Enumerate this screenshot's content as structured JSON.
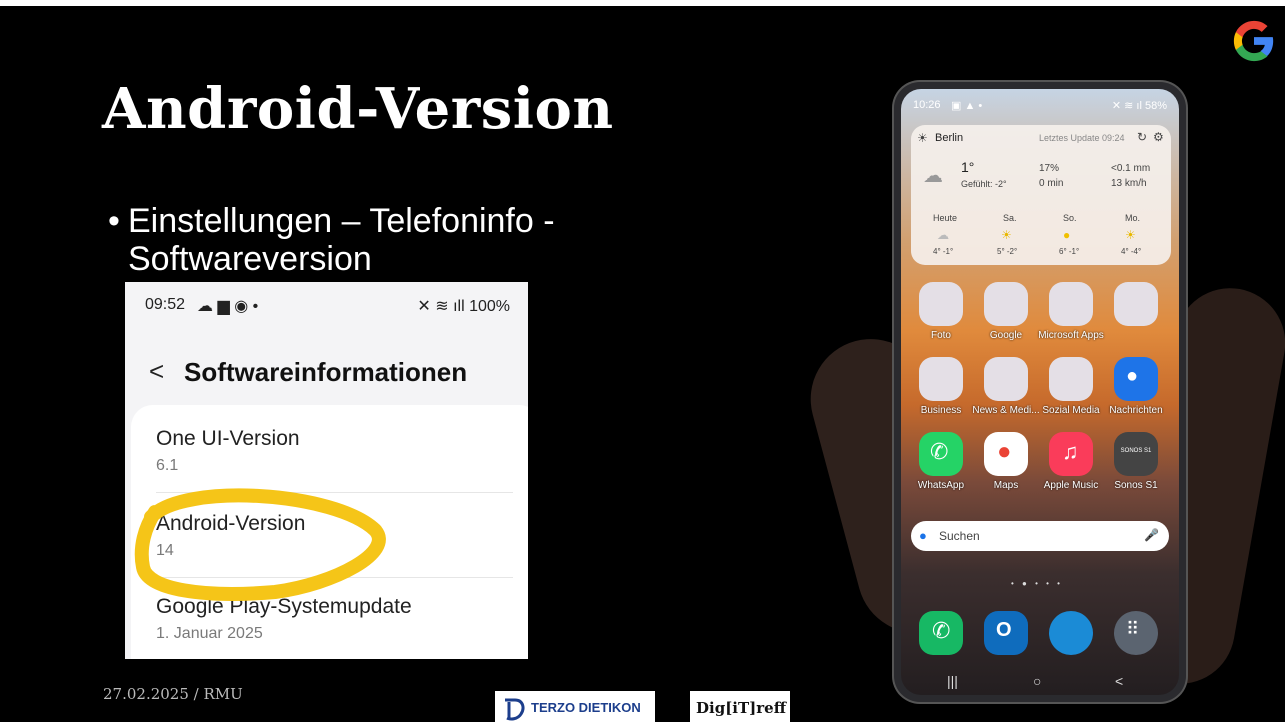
{
  "slide": {
    "title": "Android-Version",
    "bullet": "Einstellungen – Telefoninfo - Softwareversion",
    "footer_date": "27.02.2025 / RMU",
    "logo_terzo": "TERZO DIETIKON",
    "logo_digitreff": "Dig[iT]reff"
  },
  "settings_screenshot": {
    "status_time": "09:52",
    "status_right": "100%",
    "header": "Softwareinformationen",
    "items": [
      {
        "label": "One UI-Version",
        "value": "6.1"
      },
      {
        "label": "Android-Version",
        "value": "14"
      },
      {
        "label": "Google Play-Systemupdate",
        "value": "1. Januar 2025"
      }
    ],
    "highlight_color": "#f5c518"
  },
  "phone": {
    "status_time": "10:26",
    "status_battery": "58%",
    "weather": {
      "city": "Berlin",
      "updated": "Letztes Update 09:24",
      "temp": "1°",
      "feels": "Gefühlt: -2°",
      "humidity": "17%",
      "duration": "0 min",
      "rain": "<0.1 mm",
      "wind": "13 km/h",
      "forecast": [
        {
          "day": "Heute",
          "range": "4° -1°"
        },
        {
          "day": "Sa.",
          "range": "5° -2°"
        },
        {
          "day": "So.",
          "range": "6° -1°"
        },
        {
          "day": "Mo.",
          "range": "4° -4°"
        }
      ]
    },
    "row1": [
      "Foto",
      "Google",
      "Microsoft Apps",
      ""
    ],
    "row2": [
      "Business",
      "News & Medi...",
      "Sozial Media",
      "Nachrichten"
    ],
    "row3": [
      "WhatsApp",
      "Maps",
      "Apple Music",
      "Sonos S1"
    ],
    "sonos_text": "SONOS S1",
    "search_placeholder": "Suchen"
  }
}
